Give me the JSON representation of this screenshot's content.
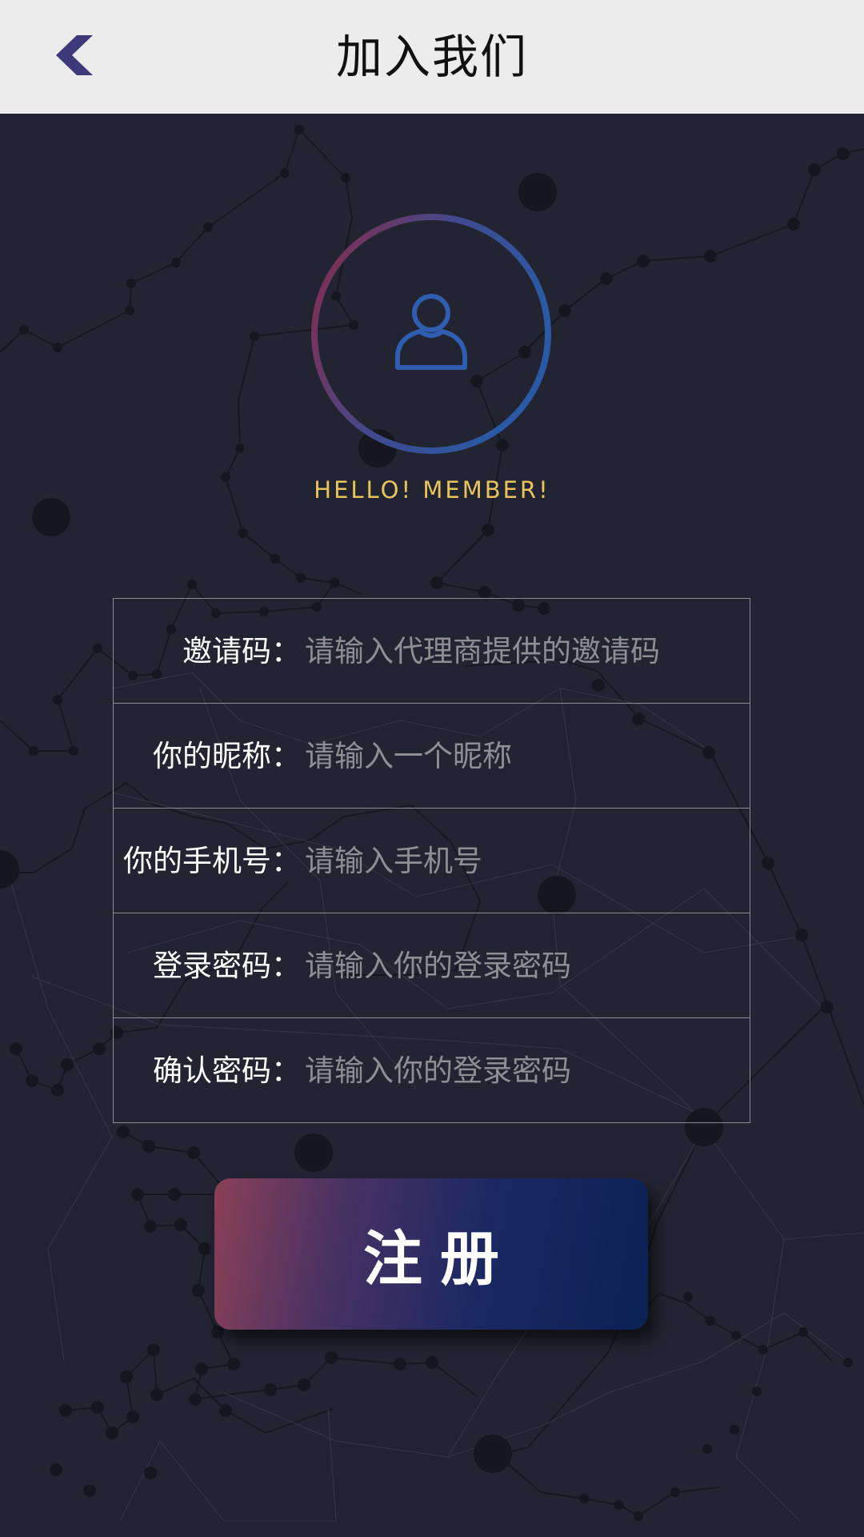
{
  "header": {
    "title": "加入我们",
    "back_icon": "chevron-left-icon",
    "back_icon_color": "#3d3a7a"
  },
  "avatar": {
    "icon": "user-icon",
    "ring_gradient": [
      "#8a2a47",
      "#2a5aa5"
    ],
    "icon_color": "#2f5db0"
  },
  "greeting": "HELLO! MEMBER!",
  "form": {
    "fields": [
      {
        "label": "邀请码：",
        "placeholder": "请输入代理商提供的邀请码",
        "value": ""
      },
      {
        "label": "你的昵称：",
        "placeholder": "请输入一个昵称",
        "value": ""
      },
      {
        "label": "你的手机号：",
        "placeholder": "请输入手机号",
        "value": ""
      },
      {
        "label": "登录密码：",
        "placeholder": "请输入你的登录密码",
        "value": ""
      },
      {
        "label": "确认密码：",
        "placeholder": "请输入你的登录密码",
        "value": ""
      }
    ]
  },
  "submit": {
    "label": "注册"
  },
  "colors": {
    "background": "#232431",
    "header_bg": "#ececec",
    "greeting": "#e7c55a",
    "button_gradient": [
      "#8a4056",
      "#0c2155"
    ]
  }
}
